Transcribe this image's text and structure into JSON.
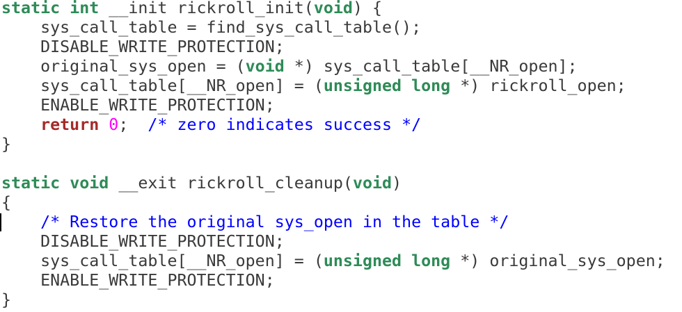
{
  "editor": {
    "lines": [
      [
        {
          "t": "static",
          "c": "kw"
        },
        {
          "t": " ",
          "c": ""
        },
        {
          "t": "int",
          "c": "kw"
        },
        {
          "t": " __init rickroll_init(",
          "c": ""
        },
        {
          "t": "void",
          "c": "kw"
        },
        {
          "t": ") {",
          "c": ""
        }
      ],
      [
        {
          "t": "    sys_call_table = find_sys_call_table();",
          "c": ""
        }
      ],
      [
        {
          "t": "    DISABLE_WRITE_PROTECTION;",
          "c": ""
        }
      ],
      [
        {
          "t": "    original_sys_open = (",
          "c": ""
        },
        {
          "t": "void",
          "c": "kw"
        },
        {
          "t": " *) sys_call_table[__NR_open];",
          "c": ""
        }
      ],
      [
        {
          "t": "    sys_call_table[__NR_open] = (",
          "c": ""
        },
        {
          "t": "unsigned",
          "c": "kw"
        },
        {
          "t": " ",
          "c": ""
        },
        {
          "t": "long",
          "c": "kw"
        },
        {
          "t": " *) rickroll_open;",
          "c": ""
        }
      ],
      [
        {
          "t": "    ENABLE_WRITE_PROTECTION;",
          "c": ""
        }
      ],
      [
        {
          "t": "    ",
          "c": ""
        },
        {
          "t": "return",
          "c": "ret"
        },
        {
          "t": " ",
          "c": ""
        },
        {
          "t": "0",
          "c": "num"
        },
        {
          "t": ";  ",
          "c": ""
        },
        {
          "t": "/* zero indicates success */",
          "c": "cmt"
        }
      ],
      [
        {
          "t": "}",
          "c": ""
        }
      ],
      [],
      [
        {
          "t": "static",
          "c": "kw"
        },
        {
          "t": " ",
          "c": ""
        },
        {
          "t": "void",
          "c": "kw"
        },
        {
          "t": " __exit rickroll_cleanup(",
          "c": ""
        },
        {
          "t": "void",
          "c": "kw"
        },
        {
          "t": ")",
          "c": ""
        }
      ],
      [
        {
          "t": "{",
          "c": ""
        }
      ],
      [
        {
          "t": "    ",
          "c": ""
        },
        {
          "t": "/* Restore the original sys_open in the table */",
          "c": "cmt"
        }
      ],
      [
        {
          "t": "    DISABLE_WRITE_PROTECTION;",
          "c": ""
        }
      ],
      [
        {
          "t": "    sys_call_table[__NR_open] = (",
          "c": ""
        },
        {
          "t": "unsigned",
          "c": "kw"
        },
        {
          "t": " ",
          "c": ""
        },
        {
          "t": "long",
          "c": "kw"
        },
        {
          "t": " *) original_sys_open;",
          "c": ""
        }
      ],
      [
        {
          "t": "    ENABLE_WRITE_PROTECTION;",
          "c": ""
        }
      ],
      [
        {
          "t": "}",
          "c": ""
        }
      ]
    ]
  },
  "colors": {
    "background": "#ffffff",
    "text": "#3a3a3a",
    "keyword": "#2e8b57",
    "return_keyword": "#a52a2a",
    "number": "#ff00ff",
    "comment": "#0000ff",
    "cursor": "#000000"
  }
}
